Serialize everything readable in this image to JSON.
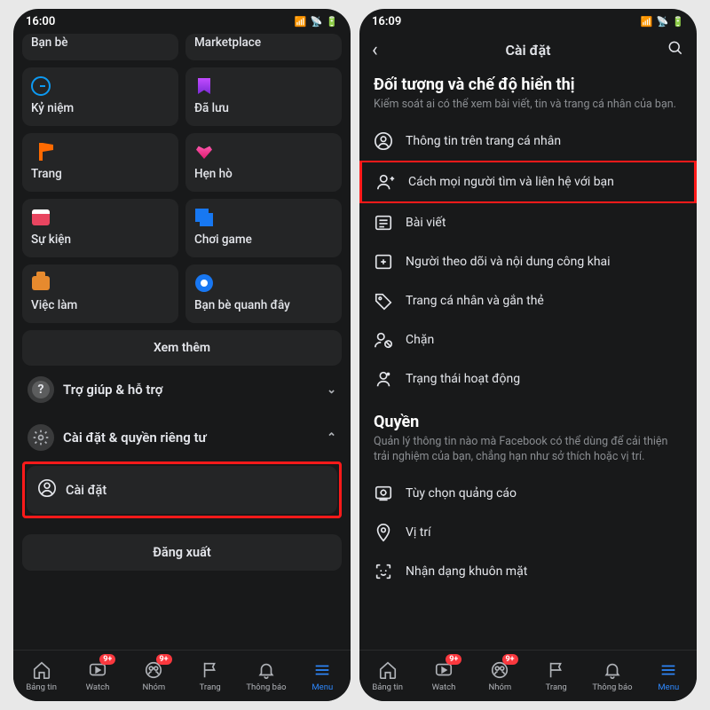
{
  "left": {
    "time": "16:00",
    "tiles": {
      "friends": "Bạn bè",
      "marketplace": "Marketplace",
      "memories": "Kỷ niệm",
      "saved": "Đã lưu",
      "pages": "Trang",
      "dating": "Hẹn hò",
      "events": "Sự kiện",
      "gaming": "Chơi game",
      "jobs": "Việc làm",
      "nearby": "Bạn bè quanh đây"
    },
    "see_more": "Xem thêm",
    "help": "Trợ giúp & hỗ trợ",
    "settings_privacy": "Cài đặt & quyền riêng tư",
    "settings": "Cài đặt",
    "logout": "Đăng xuất"
  },
  "right": {
    "time": "16:09",
    "header_title": "Cài đặt",
    "section1_title": "Đối tượng và chế độ hiển thị",
    "section1_desc": "Kiểm soát ai có thể xem bài viết, tin và trang cá nhân của bạn.",
    "items1": {
      "profile_info": "Thông tin trên trang cá nhân",
      "find_contact": "Cách mọi người tìm và liên hệ với bạn",
      "posts": "Bài viết",
      "followers": "Người theo dõi và nội dung công khai",
      "profile_tag": "Trang cá nhân và gắn thẻ",
      "blocking": "Chặn",
      "active_status": "Trạng thái hoạt động"
    },
    "section2_title": "Quyền",
    "section2_desc": "Quản lý thông tin nào mà Facebook có thể dùng để cải thiện trải nghiệm của bạn, chẳng hạn như sở thích hoặc vị trí.",
    "items2": {
      "ad_prefs": "Tùy chọn quảng cáo",
      "location": "Vị trí",
      "face_rec": "Nhận dạng khuôn mặt"
    }
  },
  "tabs": {
    "feed": "Bảng tin",
    "watch": "Watch",
    "groups": "Nhóm",
    "pages": "Trang",
    "notifications": "Thông báo",
    "menu": "Menu",
    "badge": "9+"
  }
}
